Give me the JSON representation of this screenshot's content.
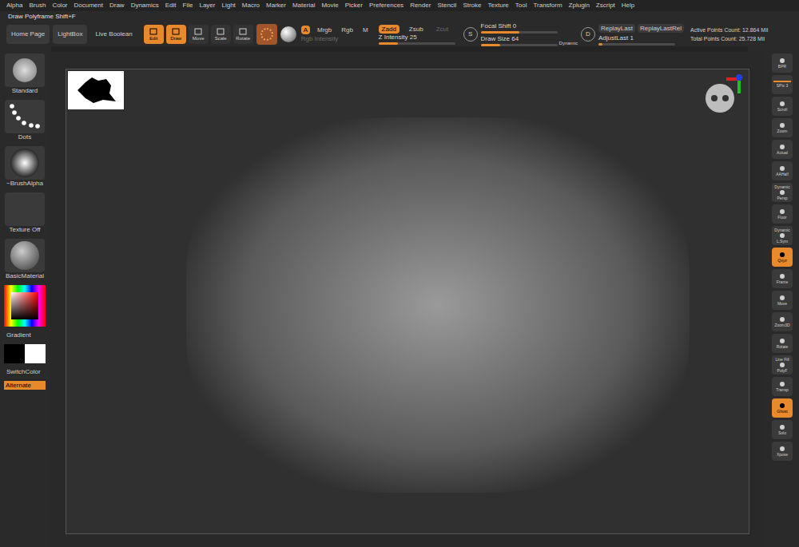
{
  "menu": [
    "Alpha",
    "Brush",
    "Color",
    "Document",
    "Draw",
    "Dynamics",
    "Edit",
    "File",
    "Layer",
    "Light",
    "Macro",
    "Marker",
    "Material",
    "Movie",
    "Picker",
    "Preferences",
    "Render",
    "Stencil",
    "Stroke",
    "Texture",
    "Tool",
    "Transform",
    "Zplugin",
    "Zscript",
    "Help"
  ],
  "title": "Draw Polyframe Shift+F",
  "toolbar": {
    "nav": [
      "Home Page",
      "LightBox",
      "Live Boolean"
    ],
    "modes": [
      {
        "label": "Edit",
        "selected": true
      },
      {
        "label": "Draw",
        "selected": true
      },
      {
        "label": "Move",
        "selected": false
      },
      {
        "label": "Scale",
        "selected": false
      },
      {
        "label": "Rotate",
        "selected": false
      }
    ],
    "color_modes": [
      {
        "label": "A",
        "selected": true
      },
      {
        "label": "Mrgb",
        "selected": false
      },
      {
        "label": "Rgb",
        "selected": false
      },
      {
        "label": "M",
        "selected": false
      }
    ],
    "rgb_intensity": {
      "label": "Rgb Intensity",
      "disabled": true
    },
    "z_modes": [
      {
        "label": "Zadd",
        "selected": true,
        "disabled": false
      },
      {
        "label": "Zsub",
        "selected": false,
        "disabled": false
      },
      {
        "label": "Zcut",
        "selected": false,
        "disabled": true
      }
    ],
    "z_intensity": {
      "label": "Z Intensity",
      "value": "25",
      "level": 0.25
    },
    "s_key": "S",
    "focal_shift": {
      "label": "Focal Shift",
      "value": "0",
      "level": 0.5
    },
    "draw_size": {
      "label": "Draw Size",
      "value": "64",
      "level": 0.25
    },
    "dynamic": "Dynamic",
    "d_key": "D",
    "replay": [
      "ReplayLast",
      "ReplayLastRel"
    ],
    "adjust_last": {
      "label": "AdjustLast",
      "value": "1",
      "level": 0.05
    },
    "active_points": "Active Points Count: 12.864 Mil",
    "total_points": "Total Points Count: 25.728 Mil"
  },
  "left_shelf": {
    "brush": "Standard",
    "stroke": "Dots",
    "alpha": "~BrushAlpha",
    "texture": "Texture Off",
    "material": "BasicMaterial",
    "gradient": "Gradient",
    "switch_color": "SwitchColor",
    "alternate": {
      "label": "Alternate",
      "selected": true
    },
    "main_color": "#000000",
    "secondary_color": "#ffffff"
  },
  "right_shelf": [
    {
      "kind": "button",
      "top": "",
      "label": "BPR",
      "selected": false
    },
    {
      "kind": "slider",
      "top": "",
      "label": "SPix 3",
      "selected": false
    },
    {
      "kind": "button",
      "top": "",
      "label": "Scroll",
      "selected": false
    },
    {
      "kind": "button",
      "top": "",
      "label": "Zoom",
      "selected": false
    },
    {
      "kind": "button",
      "top": "",
      "label": "Actual",
      "selected": false
    },
    {
      "kind": "button",
      "top": "",
      "label": "AAHalf",
      "selected": false
    },
    {
      "kind": "button",
      "top": "Dynamic",
      "label": "Persp",
      "selected": false
    },
    {
      "kind": "button",
      "top": "",
      "label": "Floor",
      "selected": false
    },
    {
      "kind": "button",
      "top": "Dynamic",
      "label": "L.Sym",
      "selected": false
    },
    {
      "kind": "button",
      "top": "",
      "label": "Qxyz",
      "selected": true
    },
    {
      "kind": "button",
      "top": "",
      "label": "Frame",
      "selected": false
    },
    {
      "kind": "button",
      "top": "",
      "label": "Move",
      "selected": false
    },
    {
      "kind": "button",
      "top": "",
      "label": "Zoom3D",
      "selected": false
    },
    {
      "kind": "button",
      "top": "",
      "label": "Rotate",
      "selected": false
    },
    {
      "kind": "button",
      "top": "Line Fill",
      "label": "PolyF",
      "selected": false
    },
    {
      "kind": "button",
      "top": "",
      "label": "Transp",
      "selected": false
    },
    {
      "kind": "button",
      "top": "",
      "label": "Ghost",
      "selected": true
    },
    {
      "kind": "button",
      "top": "",
      "label": "Solo",
      "selected": false
    },
    {
      "kind": "button",
      "top": "",
      "label": "Xpose",
      "selected": false
    }
  ]
}
